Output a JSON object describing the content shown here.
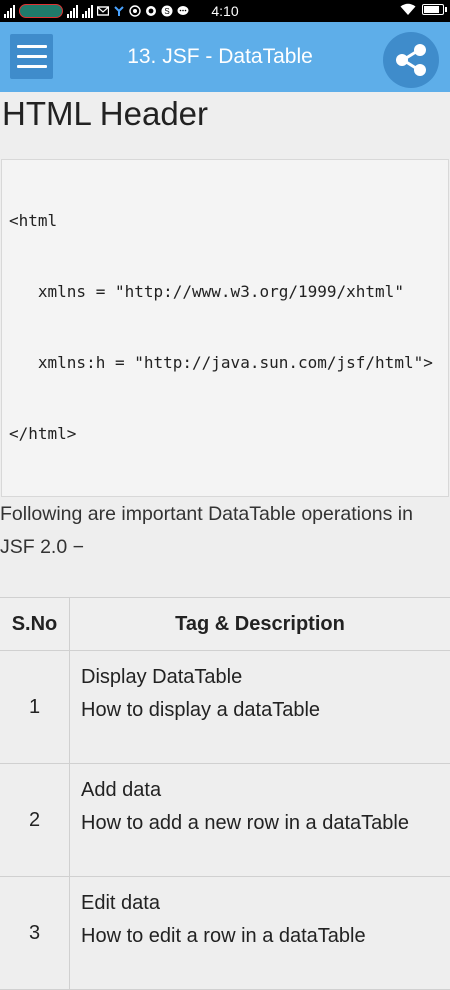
{
  "status_bar": {
    "time": "4:10",
    "icons": [
      "signal-icon",
      "carrier-icon",
      "signal-icon",
      "signal-icon",
      "mail-icon",
      "network-icon",
      "whatsapp-icon",
      "viber-icon",
      "skype-icon",
      "chat-icon",
      "wifi-icon",
      "battery-icon"
    ]
  },
  "app_bar": {
    "title": "13. JSF - DataTable",
    "menu_icon": "hamburger-menu-icon",
    "share_icon": "share-icon",
    "color": "#5eaee9",
    "button_color": "#3f8ccb"
  },
  "main": {
    "heading": "HTML Header",
    "code_lines": [
      "<html",
      "   xmlns = \"http://www.w3.org/1999/xhtml\"",
      "   xmlns:h = \"http://java.sun.com/jsf/html\">",
      "</html>"
    ],
    "intro": "Following are important DataTable operations in JSF 2.0 −",
    "table": {
      "headers": [
        "S.No",
        "Tag & Description"
      ],
      "rows": [
        {
          "sno": "1",
          "title": "Display DataTable",
          "description": "How to display a dataTable"
        },
        {
          "sno": "2",
          "title": "Add data",
          "description": "How to add a new row in a dataTable"
        },
        {
          "sno": "3",
          "title": "Edit data",
          "description": "How to edit a row in a dataTable"
        }
      ]
    }
  }
}
